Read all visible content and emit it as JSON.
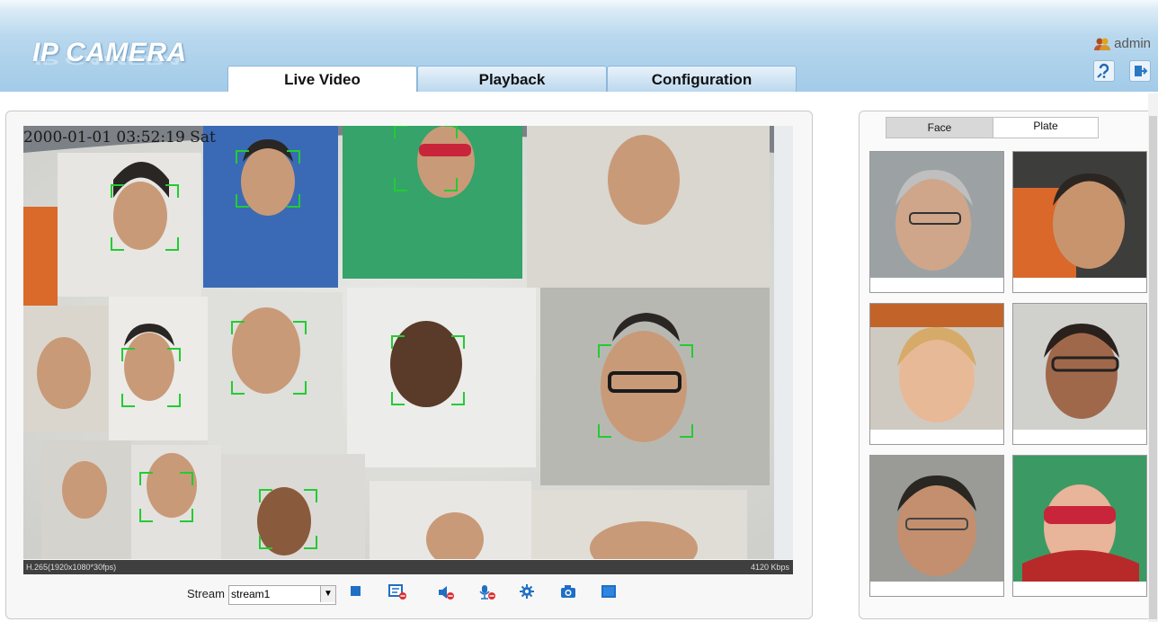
{
  "app": {
    "brand": "IP CAMERA",
    "user": "admin"
  },
  "nav": {
    "tabs": [
      {
        "label": "Live Video",
        "active": true
      },
      {
        "label": "Playback",
        "active": false
      },
      {
        "label": "Configuration",
        "active": false
      }
    ]
  },
  "header_tools": {
    "help_icon": "help-icon",
    "logout_icon": "logout-icon"
  },
  "video": {
    "osd_timestamp": "2000-01-01 03:52:19 Sat",
    "codec_info": "H.265(1920x1080*30fps)",
    "bitrate": "4120 Kbps"
  },
  "controls": {
    "stream_label": "Stream",
    "stream_value": "stream1",
    "buttons": [
      "stop-icon",
      "record-off-icon",
      "audio-off-icon",
      "mic-off-icon",
      "settings-icon",
      "snapshot-icon",
      "fullscreen-icon"
    ]
  },
  "capture_panel": {
    "tabs": [
      {
        "label": "Face",
        "active": true
      },
      {
        "label": "Plate",
        "active": false
      }
    ],
    "thumbnails": [
      "face-1",
      "face-2",
      "face-3",
      "face-4",
      "face-5",
      "face-6"
    ]
  },
  "colors": {
    "header": "#a9cfea",
    "detection_box": "#22cc33",
    "tab_active": "#ffffff"
  }
}
